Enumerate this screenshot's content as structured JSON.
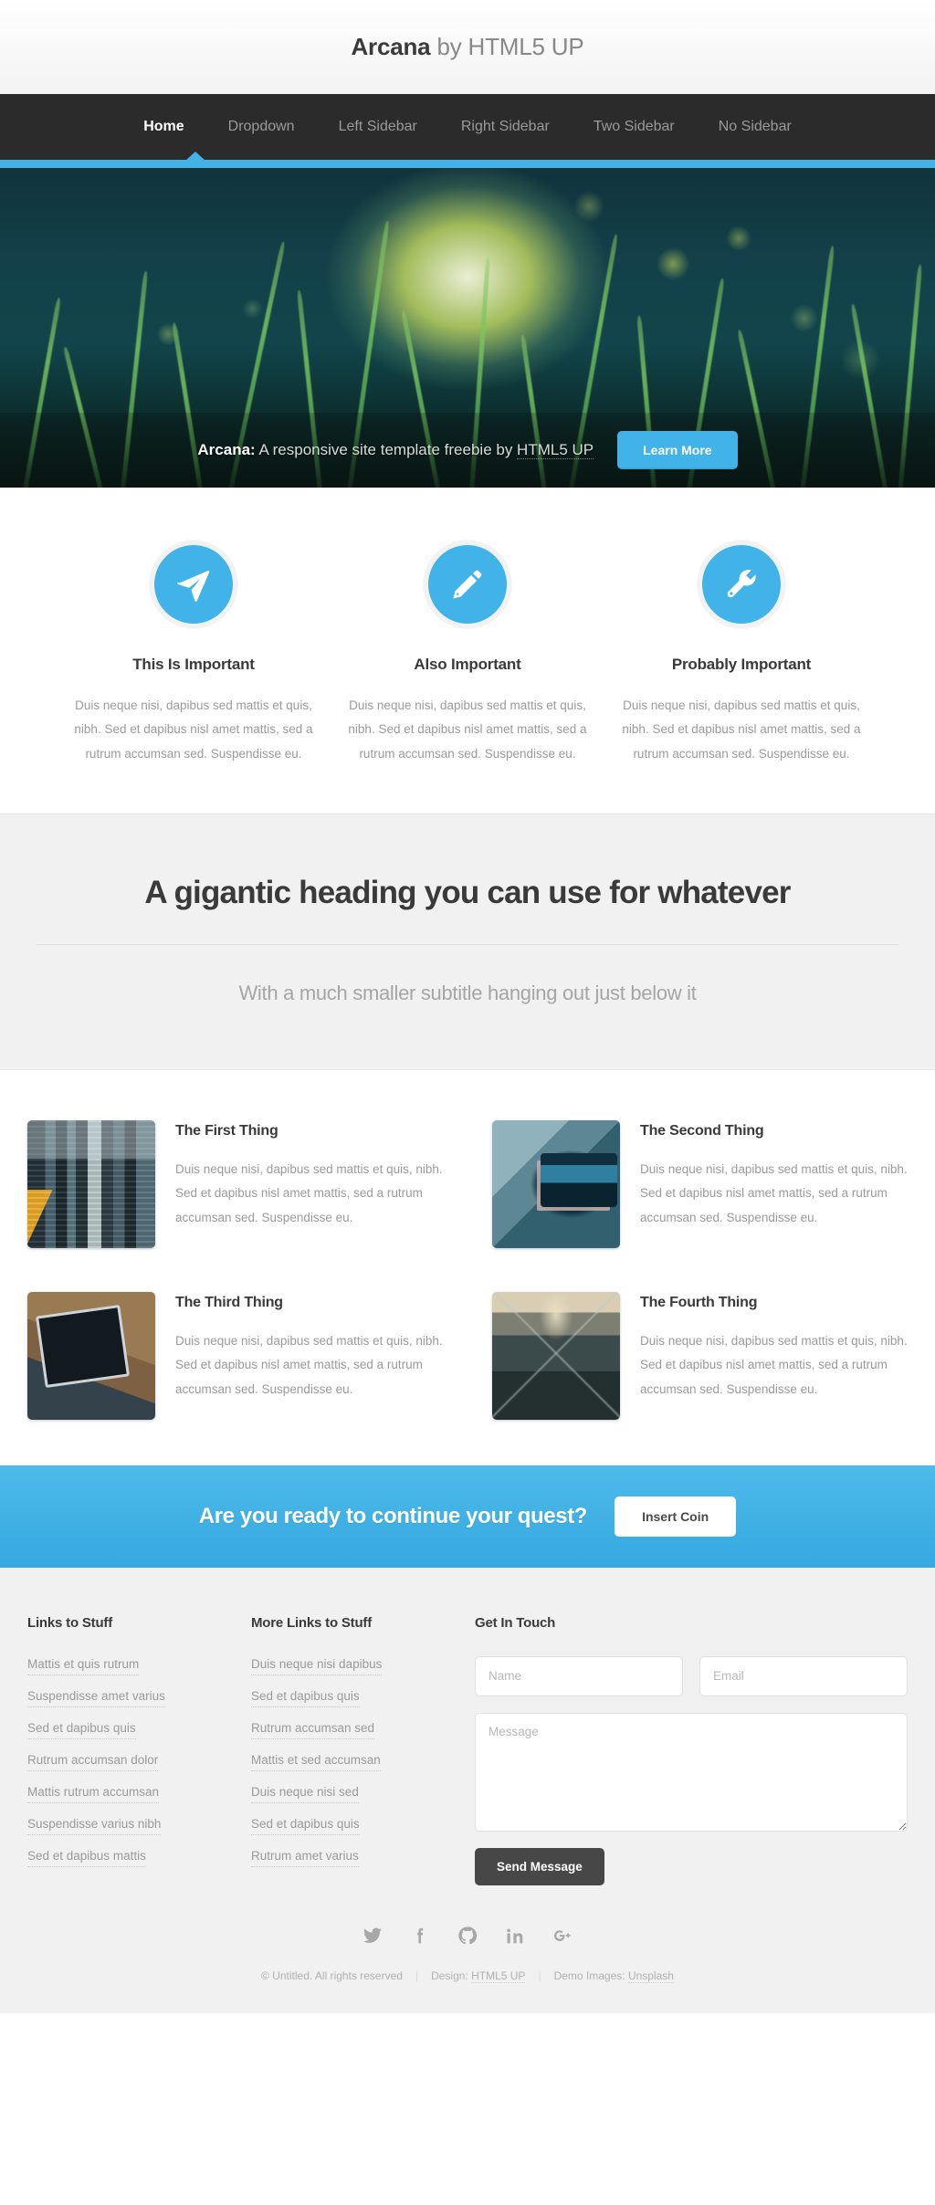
{
  "header": {
    "logo_strong": "Arcana",
    "logo_rest": " by HTML5 UP"
  },
  "nav": {
    "items": [
      {
        "label": "Home",
        "active": true
      },
      {
        "label": "Dropdown",
        "active": false
      },
      {
        "label": "Left Sidebar",
        "active": false
      },
      {
        "label": "Right Sidebar",
        "active": false
      },
      {
        "label": "Two Sidebar",
        "active": false
      },
      {
        "label": "No Sidebar",
        "active": false
      }
    ]
  },
  "banner": {
    "strong": "Arcana:",
    "text": " A responsive site template freebie by ",
    "dotted": "HTML5 UP",
    "button_label": "Learn More"
  },
  "features": [
    {
      "icon": "paper-plane-icon",
      "title": "This Is Important",
      "text": "Duis neque nisi, dapibus sed mattis et quis, nibh. Sed et dapibus nisl amet mattis, sed a rutrum accumsan sed. Suspendisse eu."
    },
    {
      "icon": "pencil-icon",
      "title": "Also Important",
      "text": "Duis neque nisi, dapibus sed mattis et quis, nibh. Sed et dapibus nisl amet mattis, sed a rutrum accumsan sed. Suspendisse eu."
    },
    {
      "icon": "wrench-icon",
      "title": "Probably Important",
      "text": "Duis neque nisi, dapibus sed mattis et quis, nibh. Sed et dapibus nisl amet mattis, sed a rutrum accumsan sed. Suspendisse eu."
    }
  ],
  "highlight": {
    "heading": "A gigantic heading you can use for whatever",
    "subtitle": "With a much smaller subtitle hanging out just below it"
  },
  "things": [
    {
      "image": "city-street-photo",
      "title": "The First Thing",
      "text": "Duis neque nisi, dapibus sed mattis et quis, nibh. Sed et dapibus nisl amet mattis, sed a rutrum accumsan sed. Suspendisse eu."
    },
    {
      "image": "hand-holding-phone-photo",
      "title": "The Second Thing",
      "text": "Duis neque nisi, dapibus sed mattis et quis, nibh. Sed et dapibus nisl amet mattis, sed a rutrum accumsan sed. Suspendisse eu."
    },
    {
      "image": "laptop-on-desk-photo",
      "title": "The Third Thing",
      "text": "Duis neque nisi, dapibus sed mattis et quis, nibh. Sed et dapibus nisl amet mattis, sed a rutrum accumsan sed. Suspendisse eu."
    },
    {
      "image": "escalator-tunnel-photo",
      "title": "The Fourth Thing",
      "text": "Duis neque nisi, dapibus sed mattis et quis, nibh. Sed et dapibus nisl amet mattis, sed a rutrum accumsan sed. Suspendisse eu."
    }
  ],
  "cta": {
    "heading": "Are you ready to continue your quest?",
    "button_label": "Insert Coin"
  },
  "footer": {
    "links1": {
      "title": "Links to Stuff",
      "items": [
        "Mattis et quis rutrum",
        "Suspendisse amet varius",
        "Sed et dapibus quis",
        "Rutrum accumsan dolor",
        "Mattis rutrum accumsan",
        "Suspendisse varius nibh",
        "Sed et dapibus mattis"
      ]
    },
    "links2": {
      "title": "More Links to Stuff",
      "items": [
        "Duis neque nisi dapibus",
        "Sed et dapibus quis",
        "Rutrum accumsan sed",
        "Mattis et sed accumsan",
        "Duis neque nisi sed",
        "Sed et dapibus quis",
        "Rutrum amet varius"
      ]
    },
    "contact": {
      "title": "Get In Touch",
      "name_placeholder": "Name",
      "name_value": "",
      "email_placeholder": "Email",
      "email_value": "",
      "message_placeholder": "Message",
      "message_value": "",
      "submit_label": "Send Message"
    },
    "social": [
      {
        "icon": "twitter-icon"
      },
      {
        "icon": "facebook-icon"
      },
      {
        "icon": "github-icon"
      },
      {
        "icon": "linkedin-icon"
      },
      {
        "icon": "google-plus-icon"
      }
    ],
    "copyright": {
      "text": "© Untitled. All rights reserved",
      "design_prefix": "Design: ",
      "design_link": "HTML5 UP",
      "images_prefix": "Demo Images: ",
      "images_link": "Unsplash"
    }
  },
  "colors": {
    "accent": "#42b3e8",
    "nav_bg": "#2b2b2b",
    "dark_text": "#3a3a3a",
    "muted_text": "#9a9a9a",
    "section_alt_bg": "#f1f1f1"
  }
}
